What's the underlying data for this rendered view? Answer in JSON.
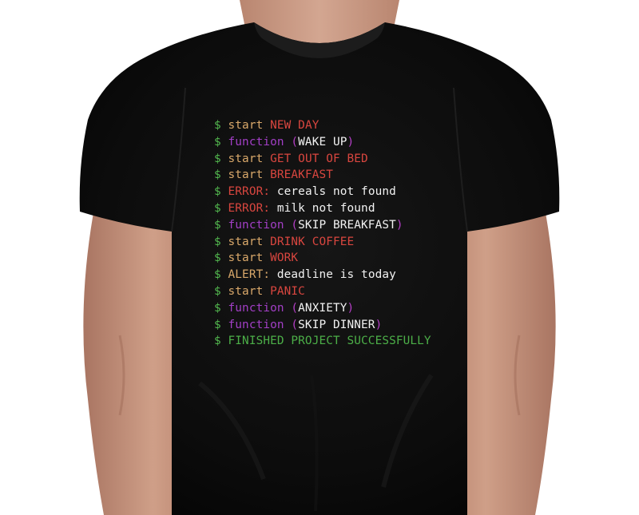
{
  "colors": {
    "dollar": "#53b84f",
    "keyword": "#d9a86a",
    "value": "#d9463f",
    "function": "#a23fc6",
    "paren": "#b43fc6",
    "plain": "#f2f2f2",
    "success": "#4caf48",
    "shirt": "#0b0b0b",
    "skin": "#c99a84",
    "background": "#ffffff"
  },
  "shirt_print": {
    "lines": [
      {
        "parts": [
          {
            "text": "$ ",
            "color": "dollar"
          },
          {
            "text": "start ",
            "color": "keyword"
          },
          {
            "text": "NEW DAY",
            "color": "value"
          }
        ]
      },
      {
        "parts": [
          {
            "text": "$ ",
            "color": "dollar"
          },
          {
            "text": "function ",
            "color": "function"
          },
          {
            "text": "(",
            "color": "paren"
          },
          {
            "text": "WAKE UP",
            "color": "plain"
          },
          {
            "text": ")",
            "color": "paren"
          }
        ]
      },
      {
        "parts": [
          {
            "text": "$ ",
            "color": "dollar"
          },
          {
            "text": "start ",
            "color": "keyword"
          },
          {
            "text": "GET OUT OF BED",
            "color": "value"
          }
        ]
      },
      {
        "parts": [
          {
            "text": "$ ",
            "color": "dollar"
          },
          {
            "text": "start ",
            "color": "keyword"
          },
          {
            "text": "BREAKFAST",
            "color": "value"
          }
        ]
      },
      {
        "parts": [
          {
            "text": "$ ",
            "color": "dollar"
          },
          {
            "text": "ERROR: ",
            "color": "value"
          },
          {
            "text": "cereals not found",
            "color": "plain"
          }
        ]
      },
      {
        "parts": [
          {
            "text": "$ ",
            "color": "dollar"
          },
          {
            "text": "ERROR: ",
            "color": "value"
          },
          {
            "text": "milk not found",
            "color": "plain"
          }
        ]
      },
      {
        "parts": [
          {
            "text": "$ ",
            "color": "dollar"
          },
          {
            "text": "function ",
            "color": "function"
          },
          {
            "text": "(",
            "color": "paren"
          },
          {
            "text": "SKIP BREAKFAST",
            "color": "plain"
          },
          {
            "text": ")",
            "color": "paren"
          }
        ]
      },
      {
        "parts": [
          {
            "text": "$ ",
            "color": "dollar"
          },
          {
            "text": "start ",
            "color": "keyword"
          },
          {
            "text": "DRINK COFFEE",
            "color": "value"
          }
        ]
      },
      {
        "parts": [
          {
            "text": "$ ",
            "color": "dollar"
          },
          {
            "text": "start ",
            "color": "keyword"
          },
          {
            "text": "WORK",
            "color": "value"
          }
        ]
      },
      {
        "parts": [
          {
            "text": "$ ",
            "color": "dollar"
          },
          {
            "text": "ALERT: ",
            "color": "keyword"
          },
          {
            "text": "deadline is today",
            "color": "plain"
          }
        ]
      },
      {
        "parts": [
          {
            "text": "$ ",
            "color": "dollar"
          },
          {
            "text": "start ",
            "color": "keyword"
          },
          {
            "text": "PANIC",
            "color": "value"
          }
        ]
      },
      {
        "parts": [
          {
            "text": "$ ",
            "color": "dollar"
          },
          {
            "text": "function ",
            "color": "function"
          },
          {
            "text": "(",
            "color": "paren"
          },
          {
            "text": "ANXIETY",
            "color": "plain"
          },
          {
            "text": ")",
            "color": "paren"
          }
        ]
      },
      {
        "parts": [
          {
            "text": "$ ",
            "color": "dollar"
          },
          {
            "text": "function ",
            "color": "function"
          },
          {
            "text": "(",
            "color": "paren"
          },
          {
            "text": "SKIP DINNER",
            "color": "plain"
          },
          {
            "text": ")",
            "color": "paren"
          }
        ]
      },
      {
        "parts": [
          {
            "text": "$ ",
            "color": "dollar"
          },
          {
            "text": "FINISHED PROJECT SUCCESSFULLY",
            "color": "success"
          }
        ]
      }
    ]
  }
}
